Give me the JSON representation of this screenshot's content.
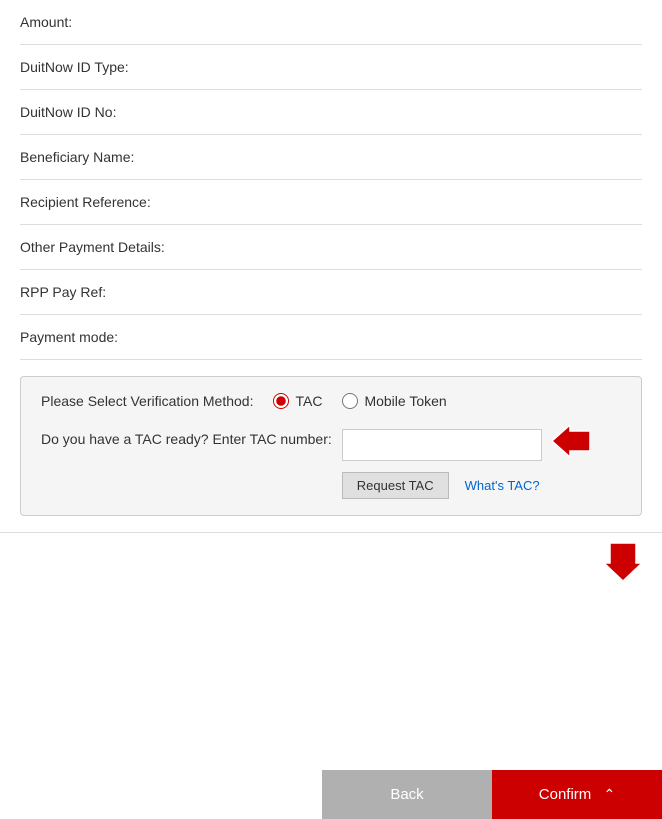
{
  "form": {
    "fields": [
      {
        "id": "amount",
        "label": "Amount:"
      },
      {
        "id": "duitnow-id-type",
        "label": "DuitNow ID Type:"
      },
      {
        "id": "duitnow-id-no",
        "label": "DuitNow ID No:"
      },
      {
        "id": "beneficiary-name",
        "label": "Beneficiary Name:"
      },
      {
        "id": "recipient-reference",
        "label": "Recipient Reference:"
      },
      {
        "id": "other-payment-details",
        "label": "Other Payment Details:"
      },
      {
        "id": "rpp-pay-ref",
        "label": "RPP Pay Ref:"
      },
      {
        "id": "payment-mode",
        "label": "Payment mode:"
      }
    ]
  },
  "verification": {
    "section_label": "Please Select Verification Method:",
    "options": [
      {
        "id": "tac",
        "label": "TAC",
        "checked": true
      },
      {
        "id": "mobile-token",
        "label": "Mobile Token",
        "checked": false
      }
    ],
    "tac_question": "Do you have a TAC ready? Enter TAC number:",
    "tac_placeholder": "",
    "request_tac_label": "Request TAC",
    "whats_tac_label": "What's TAC?"
  },
  "buttons": {
    "back_label": "Back",
    "confirm_label": "Confirm"
  }
}
